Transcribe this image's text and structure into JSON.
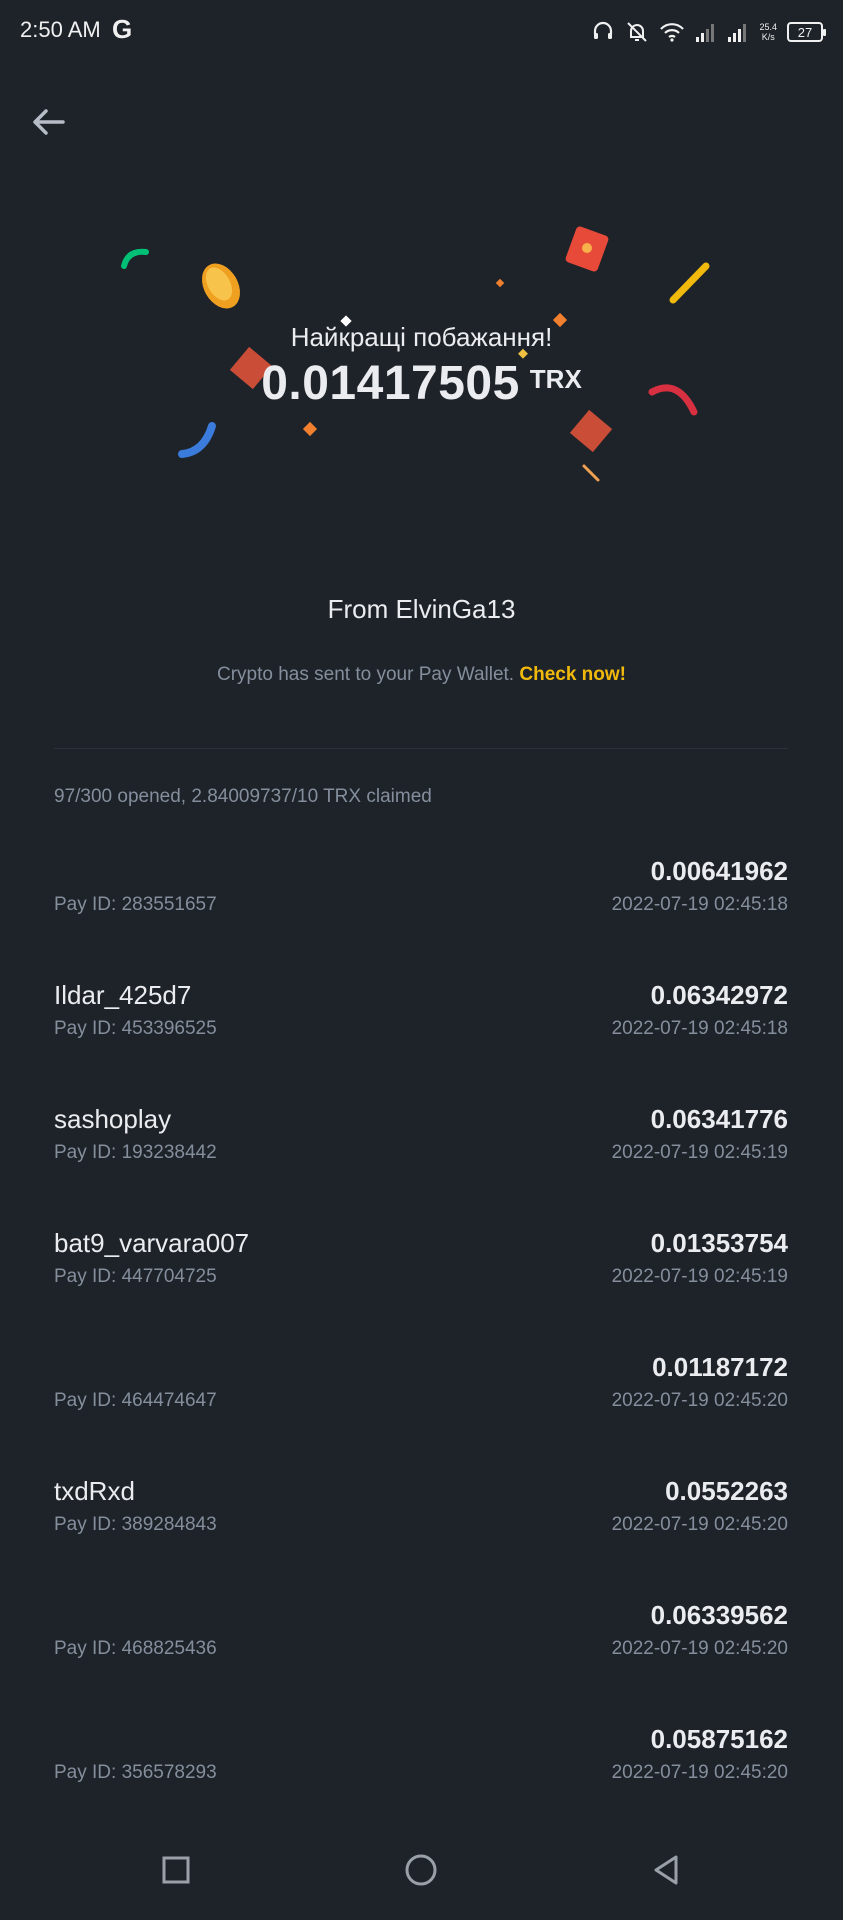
{
  "status_bar": {
    "time": "2:50 AM",
    "g_label": "G",
    "net_speed_value": "25.4",
    "net_speed_unit": "K/s",
    "battery": "27"
  },
  "header": {
    "back_icon": "arrow-left-icon"
  },
  "hero": {
    "greeting": "Найкращі побажання!",
    "amount": "0.01417505",
    "unit": "TRX"
  },
  "sender": {
    "text": "From ElvinGa13"
  },
  "notice": {
    "text": "Crypto has sent to your Pay Wallet. ",
    "link": "Check now!"
  },
  "summary": {
    "text": "97/300 opened, 2.84009737/10 TRX claimed"
  },
  "claims": [
    {
      "name": "",
      "pay_id": "Pay ID: 283551657",
      "amount": "0.00641962",
      "time": "2022-07-19 02:45:18"
    },
    {
      "name": "Ildar_425d7",
      "pay_id": "Pay ID: 453396525",
      "amount": "0.06342972",
      "time": "2022-07-19 02:45:18"
    },
    {
      "name": "sashoplay",
      "pay_id": "Pay ID: 193238442",
      "amount": "0.06341776",
      "time": "2022-07-19 02:45:19"
    },
    {
      "name": "bat9_varvara007",
      "pay_id": "Pay ID: 447704725",
      "amount": "0.01353754",
      "time": "2022-07-19 02:45:19"
    },
    {
      "name": "",
      "pay_id": "Pay ID: 464474647",
      "amount": "0.01187172",
      "time": "2022-07-19 02:45:20"
    },
    {
      "name": "txdRxd",
      "pay_id": "Pay ID: 389284843",
      "amount": "0.0552263",
      "time": "2022-07-19 02:45:20"
    },
    {
      "name": "",
      "pay_id": "Pay ID: 468825436",
      "amount": "0.06339562",
      "time": "2022-07-19 02:45:20"
    },
    {
      "name": "",
      "pay_id": "Pay ID: 356578293",
      "amount": "0.05875162",
      "time": "2022-07-19 02:45:20"
    }
  ],
  "nav": {
    "recents_icon": "square-icon",
    "home_icon": "circle-icon",
    "back_icon": "triangle-back-icon"
  },
  "colors": {
    "background": "#1e2329",
    "accent": "#f0b90b",
    "muted_text": "#848e9c",
    "primary_text": "#eaecef"
  }
}
